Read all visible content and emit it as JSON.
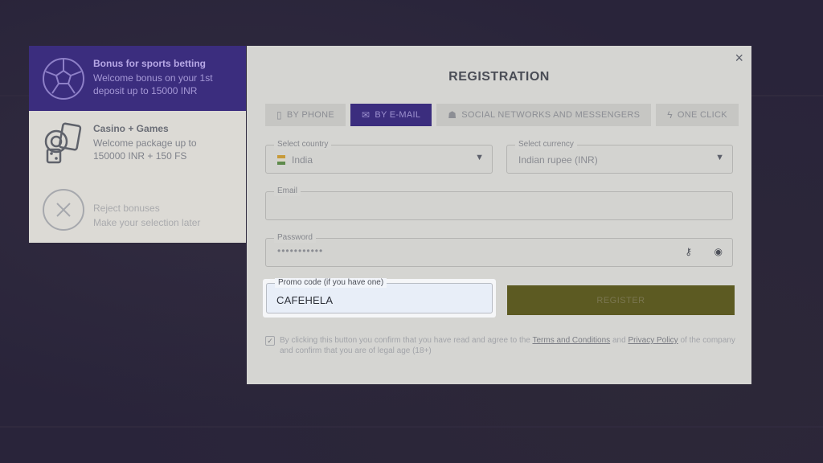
{
  "bonuses": [
    {
      "title": "Bonus for sports betting",
      "desc_line1": "Welcome bonus on your 1st",
      "desc_line2": "deposit up to 15000 INR"
    },
    {
      "title": "Casino + Games",
      "desc_line1": "Welcome package up to",
      "desc_line2": "150000 INR + 150 FS"
    },
    {
      "title": "Reject bonuses",
      "desc_line1": "Make your selection later",
      "desc_line2": ""
    }
  ],
  "modal": {
    "close_icon": "×",
    "title": "REGISTRATION",
    "tabs": [
      {
        "label": "BY PHONE",
        "icon": "phone-icon"
      },
      {
        "label": "BY E-MAIL",
        "icon": "envelope-icon"
      },
      {
        "label": "SOCIAL NETWORKS AND MESSENGERS",
        "icon": "group-icon"
      },
      {
        "label": "ONE CLICK",
        "icon": "lightning-icon"
      }
    ],
    "country": {
      "label": "Select country",
      "value": "India"
    },
    "currency": {
      "label": "Select currency",
      "value": "Indian rupee (INR)"
    },
    "email": {
      "label": "Email",
      "value": ""
    },
    "password": {
      "label": "Password",
      "value": "•••••••••••"
    },
    "promo": {
      "label": "Promo code (if you have one)",
      "value": "CAFEHELA"
    },
    "register_label": "REGISTER",
    "terms": {
      "prefix": "By clicking this button you confirm that you have read and agree to the",
      "terms_link": "Terms and Conditions",
      "and": "and",
      "privacy_link": "Privacy Policy",
      "suffix": "of the company and confirm that you are of legal age (18+)"
    }
  },
  "colors": {
    "overlay_bg": "#29243a",
    "active_purple": "#3b2d7e",
    "register_yellow": "#5c5a22",
    "promo_highlight": "#f5f6f8"
  }
}
